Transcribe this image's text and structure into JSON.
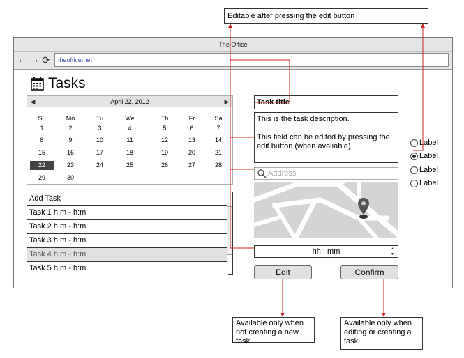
{
  "window": {
    "title": "The Office",
    "url": "theoffice.net"
  },
  "page": {
    "title": "Tasks"
  },
  "calendar": {
    "month_label": "April 22, 2012",
    "weekdays": [
      "Su",
      "Mo",
      "Tu",
      "We",
      "Th",
      "Fr",
      "Sa"
    ],
    "weeks": [
      [
        "1",
        "2",
        "3",
        "4",
        "5",
        "6",
        "7"
      ],
      [
        "8",
        "9",
        "10",
        "11",
        "12",
        "13",
        "14"
      ],
      [
        "15",
        "16",
        "17",
        "18",
        "19",
        "20",
        "21"
      ],
      [
        "22",
        "23",
        "24",
        "25",
        "26",
        "27",
        "28"
      ],
      [
        "29",
        "30",
        "",
        "",
        "",
        "",
        ""
      ]
    ],
    "selected_day": "22"
  },
  "tasks": {
    "add_label": "Add Task",
    "items": [
      "Task 1 h:m - h:m",
      "Task 2 h:m - h:m",
      "Task 3 h:m - h:m",
      "Task 4 h:m - h:m",
      "Task 5 h:m - h:m"
    ],
    "selected_index": 3
  },
  "details": {
    "title": "Task title",
    "description_line1": "This is the task description.",
    "description_line2": "This field can be edited by pressing the edit button (when avaliable)",
    "address_placeholder": "Address",
    "time_value": "hh : mm",
    "edit_label": "Edit",
    "confirm_label": "Confirm"
  },
  "radios": {
    "items": [
      "Label",
      "Label",
      "Label",
      "Label"
    ],
    "selected_index": 1
  },
  "notes": {
    "top": "Editable after pressing the edit button",
    "edit": "Available only when not creating a new task",
    "confirm": "Available only when editing or creating a task"
  },
  "colors": {
    "annotation": "#cc2222",
    "selected_day_bg": "#444444",
    "url_text": "#3a4db0"
  }
}
